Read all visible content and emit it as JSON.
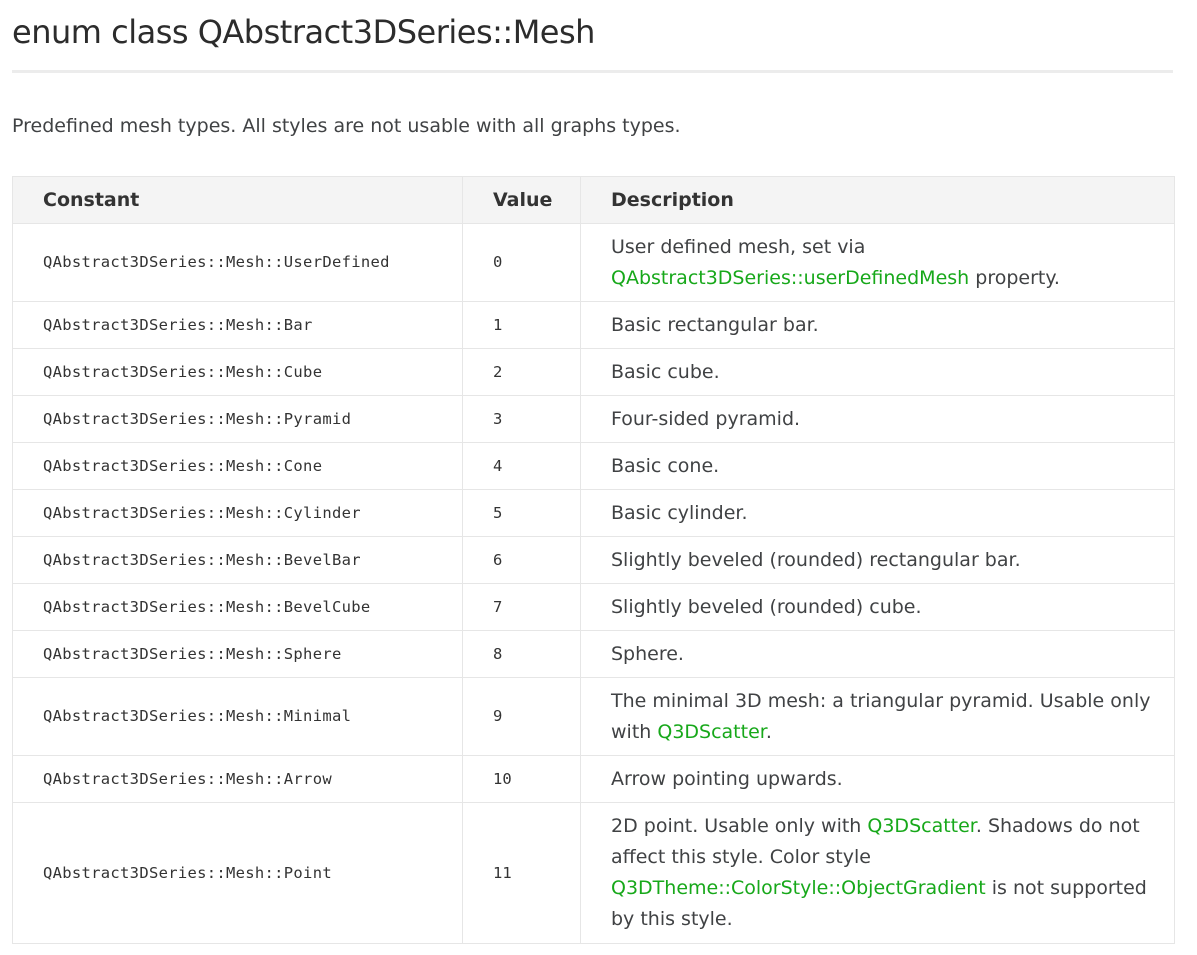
{
  "page": {
    "title": "enum class QAbstract3DSeries::Mesh",
    "intro": "Predefined mesh types. All styles are not usable with all graphs types."
  },
  "table": {
    "headers": {
      "constant": "Constant",
      "value": "Value",
      "description": "Description"
    },
    "rows": [
      {
        "constant": "QAbstract3DSeries::Mesh::UserDefined",
        "value": "0",
        "desc": [
          {
            "text": "User defined mesh, set via "
          },
          {
            "text": "QAbstract3DSeries::userDefinedMesh",
            "link": true
          },
          {
            "text": " property."
          }
        ]
      },
      {
        "constant": "QAbstract3DSeries::Mesh::Bar",
        "value": "1",
        "desc": [
          {
            "text": "Basic rectangular bar."
          }
        ]
      },
      {
        "constant": "QAbstract3DSeries::Mesh::Cube",
        "value": "2",
        "desc": [
          {
            "text": "Basic cube."
          }
        ]
      },
      {
        "constant": "QAbstract3DSeries::Mesh::Pyramid",
        "value": "3",
        "desc": [
          {
            "text": "Four-sided pyramid."
          }
        ]
      },
      {
        "constant": "QAbstract3DSeries::Mesh::Cone",
        "value": "4",
        "desc": [
          {
            "text": "Basic cone."
          }
        ]
      },
      {
        "constant": "QAbstract3DSeries::Mesh::Cylinder",
        "value": "5",
        "desc": [
          {
            "text": "Basic cylinder."
          }
        ]
      },
      {
        "constant": "QAbstract3DSeries::Mesh::BevelBar",
        "value": "6",
        "desc": [
          {
            "text": "Slightly beveled (rounded) rectangular bar."
          }
        ]
      },
      {
        "constant": "QAbstract3DSeries::Mesh::BevelCube",
        "value": "7",
        "desc": [
          {
            "text": "Slightly beveled (rounded) cube."
          }
        ]
      },
      {
        "constant": "QAbstract3DSeries::Mesh::Sphere",
        "value": "8",
        "desc": [
          {
            "text": "Sphere."
          }
        ]
      },
      {
        "constant": "QAbstract3DSeries::Mesh::Minimal",
        "value": "9",
        "desc": [
          {
            "text": "The minimal 3D mesh: a triangular pyramid. Usable only with "
          },
          {
            "text": "Q3DScatter",
            "link": true
          },
          {
            "text": "."
          }
        ]
      },
      {
        "constant": "QAbstract3DSeries::Mesh::Arrow",
        "value": "10",
        "desc": [
          {
            "text": "Arrow pointing upwards."
          }
        ]
      },
      {
        "constant": "QAbstract3DSeries::Mesh::Point",
        "value": "11",
        "desc": [
          {
            "text": "2D point. Usable only with "
          },
          {
            "text": "Q3DScatter",
            "link": true
          },
          {
            "text": ". Shadows do not affect this style. Color style "
          },
          {
            "text": "Q3DTheme::ColorStyle::ObjectGradient",
            "link": true
          },
          {
            "text": " is not supported by this style."
          }
        ]
      }
    ]
  },
  "colors": {
    "link": "#17a81a",
    "text": "#404244",
    "header_bg": "#f4f4f4",
    "border": "#e6e6e6"
  }
}
